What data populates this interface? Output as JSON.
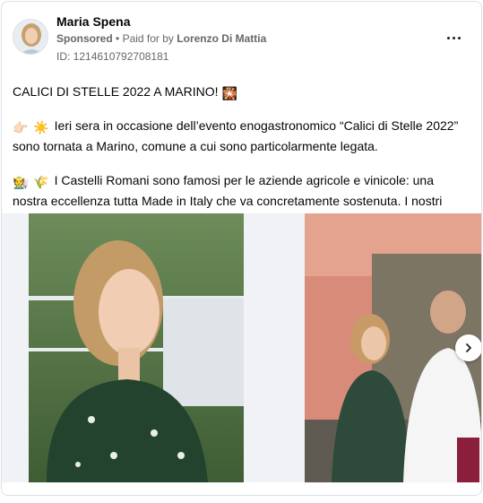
{
  "post": {
    "author_name": "Maria Spena",
    "sponsored": "Sponsored",
    "separator": "•",
    "paid_for_prefix": "Paid for by",
    "paid_for_by": "Lorenzo Di Mattia",
    "library_id": "ID: 1214610792708181",
    "paragraph1": "CALICI DI STELLE 2022 A MARINO!",
    "paragraph2": "Ieri sera in occasione dell’evento enogastronomico “Calici di Stelle 2022” sono tornata a Marino, comune a cui sono particolarmente legata.",
    "paragraph3": "I Castelli Romani sono famosi per le aziende agricole e vinicole: una nostra eccellenza tutta Made in Italy che va concretamente sostenuta. I nostri prodotti…",
    "emoji_fireworks": "🎇",
    "emoji_pointing": "👉🏻",
    "emoji_sun": "☀️",
    "emoji_farmer": "🧑‍🌾",
    "emoji_grain": "🌾"
  },
  "icons": {
    "more": "more-options-icon",
    "next": "chevron-right-icon"
  },
  "colors": {
    "secondary_text": "#65676b",
    "border": "#dcdfe3",
    "background_gray": "#f0f2f5"
  }
}
